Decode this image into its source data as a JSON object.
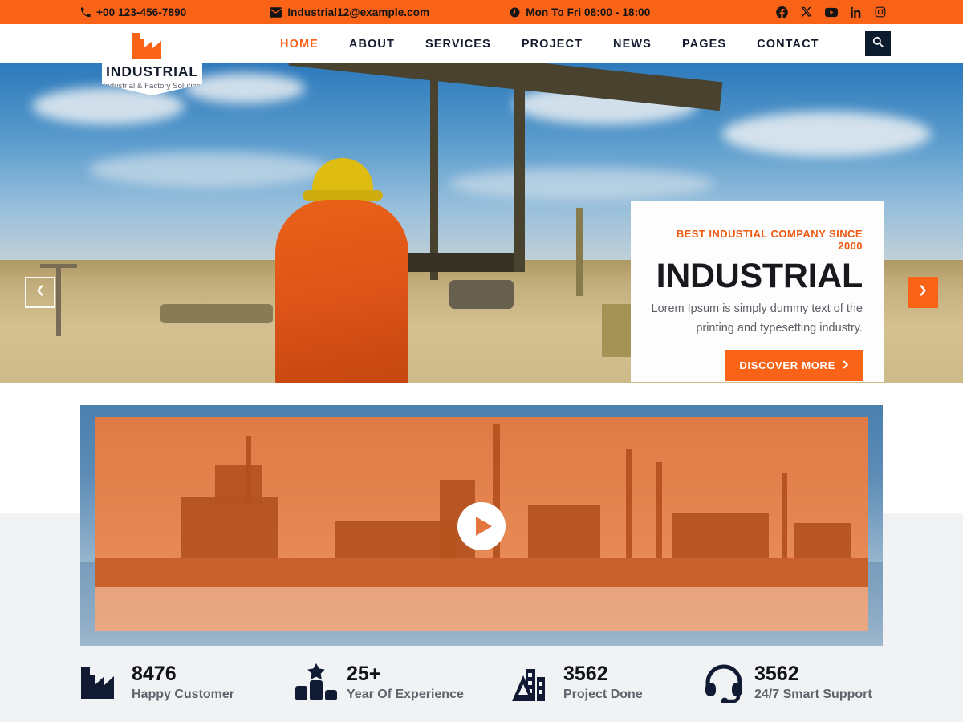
{
  "colors": {
    "brand_orange": "#f96317",
    "navy": "#0d1b2f",
    "gray_band": "#f1f2f4",
    "text_muted": "#5e636c"
  },
  "topbar": {
    "phone": "+00 123-456-7890",
    "email": "Industrial12@example.com",
    "hours": "Mon To Fri 08:00 - 18:00",
    "icons": {
      "phone": "phone-icon",
      "email": "envelope-icon",
      "hours": "clock-icon"
    },
    "social": [
      {
        "name": "facebook-icon",
        "label": "Facebook"
      },
      {
        "name": "x-twitter-icon",
        "label": "X"
      },
      {
        "name": "youtube-icon",
        "label": "YouTube"
      },
      {
        "name": "linkedin-icon",
        "label": "LinkedIn"
      },
      {
        "name": "instagram-icon",
        "label": "Instagram"
      }
    ]
  },
  "logo": {
    "name": "INDUSTRIAL",
    "tagline": "Industrial & Factory Solution",
    "mark": "factory-icon"
  },
  "nav": {
    "items": [
      {
        "label": "HOME",
        "active": true
      },
      {
        "label": "ABOUT",
        "active": false
      },
      {
        "label": "SERVICES",
        "active": false
      },
      {
        "label": "PROJECT",
        "active": false
      },
      {
        "label": "NEWS",
        "active": false
      },
      {
        "label": "PAGES",
        "active": false
      },
      {
        "label": "CONTACT",
        "active": false
      }
    ],
    "search_icon": "search-icon"
  },
  "hero": {
    "eyebrow": "BEST INDUSTIAL COMPANY SINCE 2000",
    "title": "INDUSTRIAL",
    "subtitle": "Lorem Ipsum is simply dummy text of the printing and typesetting industry.",
    "cta_label": "DISCOVER MORE",
    "cta_arrow": "chevron-right-icon",
    "prev_icon": "chevron-left-icon",
    "next_icon": "chevron-right-icon"
  },
  "video": {
    "play_icon": "play-icon"
  },
  "stats": [
    {
      "icon": "factory-icon",
      "number": "8476",
      "label": "Happy Customer"
    },
    {
      "icon": "award-bars-icon",
      "number": "25+",
      "label": "Year Of Experience"
    },
    {
      "icon": "buildings-icon",
      "number": "3562",
      "label": "Project Done"
    },
    {
      "icon": "headset-icon",
      "number": "3562",
      "label": "24/7 Smart Support"
    }
  ]
}
